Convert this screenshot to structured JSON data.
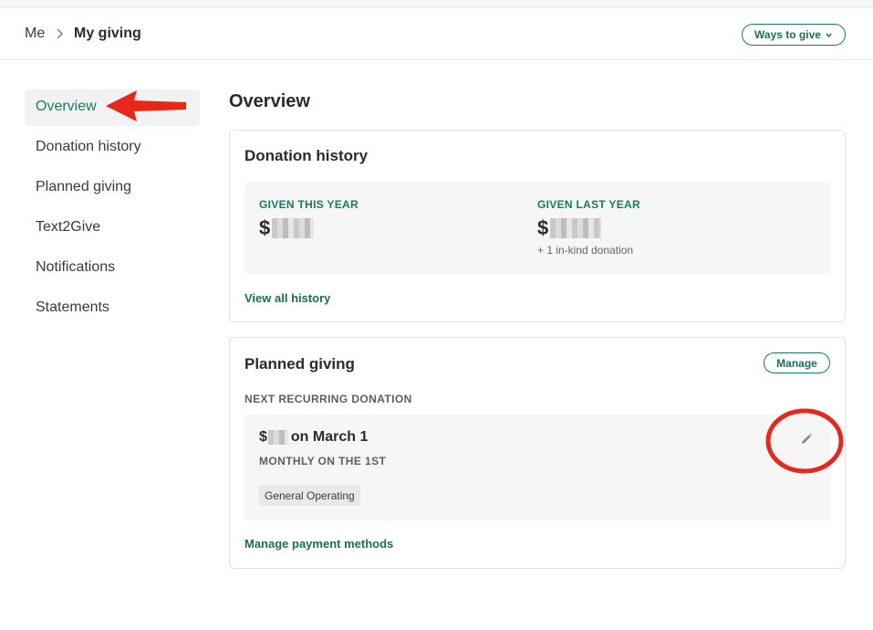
{
  "breadcrumb": {
    "root": "Me",
    "current": "My giving"
  },
  "header": {
    "ways_to_give_label": "Ways to give"
  },
  "sidebar": {
    "items": [
      {
        "label": "Overview",
        "active": true
      },
      {
        "label": "Donation history",
        "active": false
      },
      {
        "label": "Planned giving",
        "active": false
      },
      {
        "label": "Text2Give",
        "active": false
      },
      {
        "label": "Notifications",
        "active": false
      },
      {
        "label": "Statements",
        "active": false
      }
    ]
  },
  "main": {
    "title": "Overview",
    "donation_history": {
      "title": "Donation history",
      "given_this_year_label": "GIVEN THIS YEAR",
      "given_this_year_value": "$",
      "given_last_year_label": "GIVEN LAST YEAR",
      "given_last_year_value": "$",
      "in_kind_note": "+ 1 in-kind donation",
      "view_all_link": "View all history"
    },
    "planned_giving": {
      "title": "Planned giving",
      "manage_label": "Manage",
      "next_label": "NEXT RECURRING DONATION",
      "amount_prefix": "$",
      "date_text": "on March 1",
      "frequency": "MONTHLY ON THE 1ST",
      "fund_tag": "General Operating",
      "payment_link": "Manage payment methods"
    }
  },
  "colors": {
    "accent": "#1b7a67",
    "annotation": "#e8271b"
  },
  "icons": [
    "chevron-right-icon",
    "chevron-down-icon",
    "pencil-icon"
  ]
}
